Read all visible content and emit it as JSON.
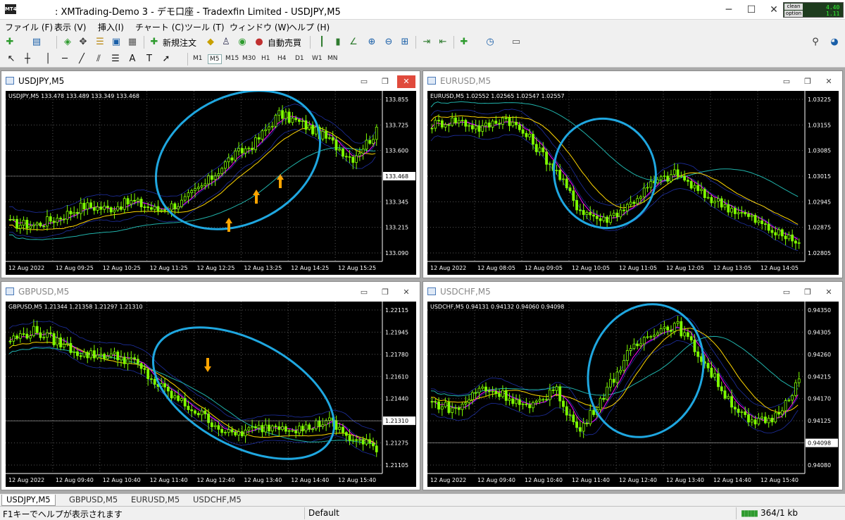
{
  "titlebar": {
    "title": ": XMTrading-Demo 3 - デモ口座 - Tradexfin Limited - USDJPY,M5",
    "icon": "MT4",
    "minimize": "─",
    "maximize": "☐",
    "close": "✕",
    "clean": "clean",
    "option": "option",
    "cpu": "4.40\n1.11"
  },
  "menu": [
    "ファイル (F)",
    "表示 (V)",
    "挿入(I)",
    "チャート (C)",
    "ツール (T)",
    "ウィンドウ (W)",
    "ヘルプ (H)"
  ],
  "toolbar": {
    "new_order": "新規注文",
    "auto_trading": "自動売買",
    "timeframes": [
      "M1",
      "M5",
      "M15",
      "M30",
      "H1",
      "H4",
      "D1",
      "W1",
      "MN"
    ],
    "active_tf": "M5"
  },
  "windows": [
    {
      "title": "USDJPY,M5",
      "ohlc": "USDJPY,M5  133.478 133.489 133.349 133.468",
      "yticks": [
        "133.855",
        "133.725",
        "133.600",
        "133.468",
        "133.345",
        "133.215",
        "133.090"
      ],
      "highlight": "133.468",
      "xticks": [
        "12 Aug 2022",
        "12 Aug 09:25",
        "12 Aug 10:25",
        "12 Aug 11:25",
        "12 Aug 12:25",
        "12 Aug 13:25",
        "12 Aug 14:25",
        "12 Aug 15:25"
      ],
      "active": true
    },
    {
      "title": "EURUSD,M5",
      "ohlc": "EURUSD,M5  1.02552 1.02565 1.02547 1.02557",
      "yticks": [
        "1.03225",
        "1.03155",
        "1.03085",
        "1.03015",
        "1.02945",
        "1.02875",
        "1.02805"
      ],
      "highlight": "",
      "xticks": [
        "12 Aug 2022",
        "12 Aug 08:05",
        "12 Aug 09:05",
        "12 Aug 10:05",
        "12 Aug 11:05",
        "12 Aug 12:05",
        "12 Aug 13:05",
        "12 Aug 14:05"
      ],
      "active": false
    },
    {
      "title": "GBPUSD,M5",
      "ohlc": "GBPUSD,M5  1.21344 1.21358 1.21297 1.21310",
      "yticks": [
        "1.22115",
        "1.21945",
        "1.21780",
        "1.21610",
        "1.21440",
        "1.21310",
        "1.21275",
        "1.21105"
      ],
      "highlight": "1.21310",
      "xticks": [
        "12 Aug 2022",
        "12 Aug 09:40",
        "12 Aug 10:40",
        "12 Aug 11:40",
        "12 Aug 12:40",
        "12 Aug 13:40",
        "12 Aug 14:40",
        "12 Aug 15:40"
      ],
      "active": false
    },
    {
      "title": "USDCHF,M5",
      "ohlc": "USDCHF,M5  0.94131 0.94132 0.94060 0.94098",
      "yticks": [
        "0.94350",
        "0.94305",
        "0.94260",
        "0.94215",
        "0.94170",
        "0.94125",
        "0.94098",
        "0.94080"
      ],
      "highlight": "0.94098",
      "xticks": [
        "12 Aug 2022",
        "12 Aug 09:40",
        "12 Aug 10:40",
        "12 Aug 11:40",
        "12 Aug 12:40",
        "12 Aug 13:40",
        "12 Aug 14:40",
        "12 Aug 15:40"
      ],
      "active": false
    }
  ],
  "tabs": [
    "USDJPY,M5",
    "GBPUSD,M5",
    "EURUSD,M5",
    "USDCHF,M5"
  ],
  "status": {
    "help": "F1キーでヘルプが表示されます",
    "profile": "Default",
    "traffic": "364/1 kb"
  },
  "colors": {
    "chart_bg": "#000000",
    "candle": "#7fff00",
    "ellipse": "#1fa7e0",
    "arrow": "#ffa500",
    "ma_fast": "#ff00ff",
    "ma_mid": "#ffd700",
    "ma_slow": "#20b2aa",
    "band": "#1e2fa0"
  }
}
